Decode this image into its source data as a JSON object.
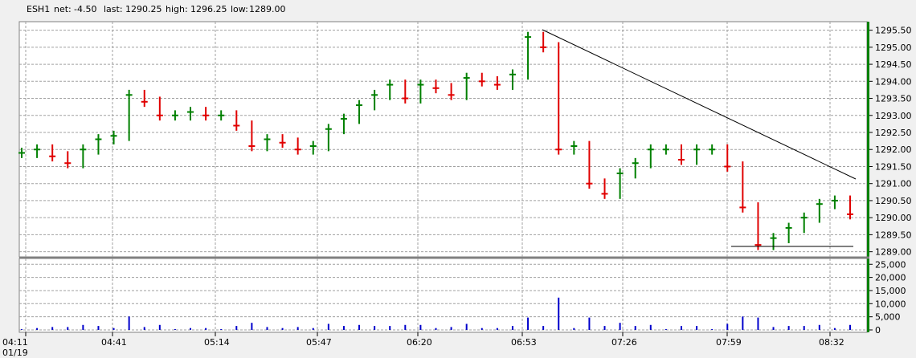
{
  "header": {
    "symbol": "ESH1",
    "net_label": "net:",
    "net": "-4.50",
    "last_label": "last:",
    "last": "1290.25",
    "high_label": "high:",
    "high": "1296.25",
    "low_label": "low:",
    "low": "1289.00"
  },
  "chart_data": [
    {
      "type": "line",
      "panel": "price",
      "description_free": true,
      "x_ticks": [
        "04:11",
        "04:41",
        "05:14",
        "05:47",
        "06:20",
        "06:53",
        "07:26",
        "07:59",
        "08:32"
      ],
      "x_subtick": "01/19",
      "y_ticks": [
        "1289.00",
        "1289.50",
        "1290.00",
        "1290.50",
        "1291.00",
        "1291.50",
        "1292.00",
        "1292.50",
        "1293.00",
        "1293.50",
        "1294.00",
        "1294.50",
        "1295.00",
        "1295.50"
      ],
      "ylim": [
        1288.85,
        1295.75
      ],
      "grid": true,
      "x": [
        "04:11",
        "04:16",
        "04:21",
        "04:26",
        "04:31",
        "04:36",
        "04:41",
        "04:46",
        "04:51",
        "04:56",
        "05:01",
        "05:06",
        "05:11",
        "05:16",
        "05:21",
        "05:26",
        "05:31",
        "05:36",
        "05:41",
        "05:46",
        "05:51",
        "05:56",
        "06:01",
        "06:06",
        "06:11",
        "06:16",
        "06:21",
        "06:26",
        "06:31",
        "06:36",
        "06:41",
        "06:46",
        "06:51",
        "06:56",
        "07:01",
        "07:06",
        "07:11",
        "07:16",
        "07:21",
        "07:26",
        "07:31",
        "07:36",
        "07:41",
        "07:46",
        "07:51",
        "07:56",
        "08:01",
        "08:06",
        "08:11",
        "08:16",
        "08:21",
        "08:26",
        "08:31",
        "08:36",
        "08:40"
      ],
      "series": [
        {
          "values": [
            1291.9,
            1292.0,
            1291.8,
            1291.6,
            1292.0,
            1292.3,
            1292.4,
            1293.6,
            1293.4,
            1293.0,
            1293.0,
            1293.1,
            1293.0,
            1293.0,
            1292.7,
            1292.1,
            1292.3,
            1292.2,
            1292.0,
            1292.1,
            1292.6,
            1292.9,
            1293.3,
            1293.6,
            1293.9,
            1293.5,
            1293.9,
            1293.8,
            1293.6,
            1294.1,
            1294.0,
            1293.9,
            1294.2,
            1295.3,
            1295.0,
            1292.0,
            1292.1,
            1291.0,
            1290.7,
            1291.3,
            1291.6,
            1292.0,
            1292.0,
            1291.7,
            1292.0,
            1292.0,
            1291.5,
            1290.3,
            1289.2,
            1289.4,
            1289.7,
            1290.0,
            1290.4,
            1290.5,
            1290.1,
            1290.4,
            1291.2,
            1289.3,
            1290.2
          ]
        }
      ],
      "colors": {
        "up": "#008000",
        "down": "#e00000",
        "trendline": "#000000",
        "grid": "#a0a0a0"
      }
    },
    {
      "type": "bar",
      "panel": "volume",
      "y_ticks": [
        "0",
        "5,000",
        "10,000",
        "15,000",
        "20,000",
        "25,000"
      ],
      "ylim": [
        0,
        26000
      ],
      "grid": true,
      "color": "#0000cc"
    }
  ]
}
